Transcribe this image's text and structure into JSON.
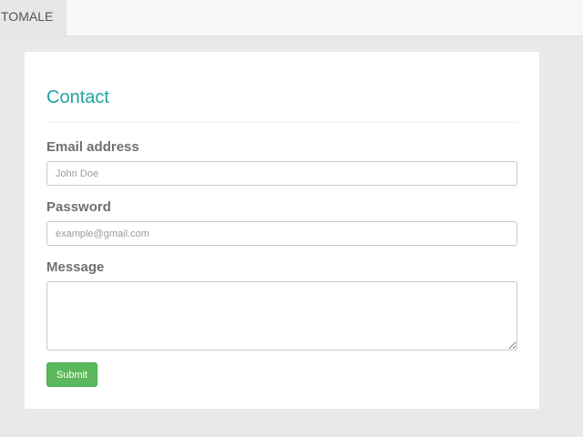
{
  "navbar": {
    "brand": "TOMALE"
  },
  "contact": {
    "title": "Contact",
    "email": {
      "label": "Email address",
      "placeholder": "John Doe",
      "value": ""
    },
    "password": {
      "label": "Password",
      "placeholder": "example@gmail.com",
      "value": ""
    },
    "message": {
      "label": "Message",
      "value": ""
    },
    "submit_label": "Submit"
  },
  "colors": {
    "accent": "#1fa3a3",
    "submit": "#5cb85c",
    "background": "#e9e9e9"
  }
}
